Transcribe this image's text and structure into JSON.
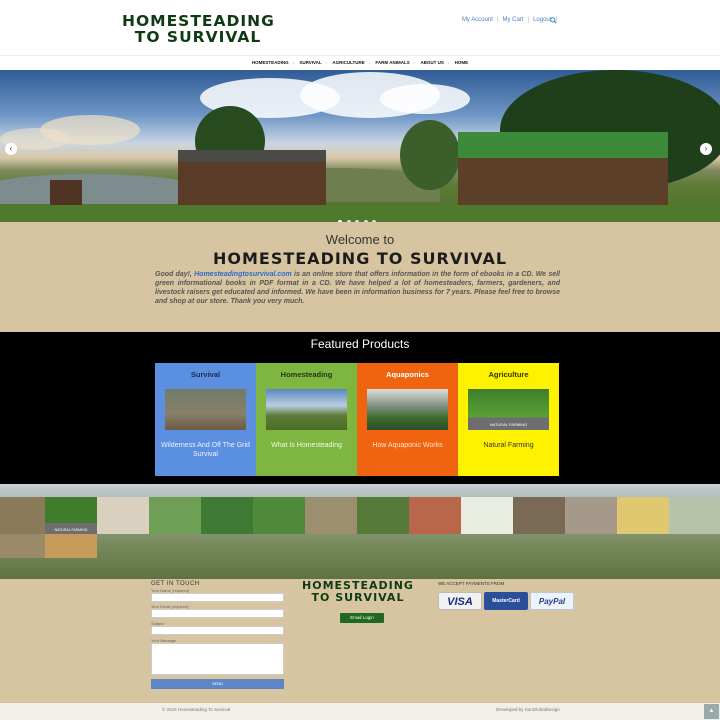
{
  "header": {
    "logo_line1": "HOMESTEADING",
    "logo_line2": "TO SURVIVAL",
    "my_account": "My Account",
    "my_cart": "My Cart",
    "logout": "Logout",
    "sep": "|"
  },
  "nav": {
    "items": [
      "HOMESTEADING",
      "SURVIVAL",
      "AGRICULTURE",
      "FARM ANIMALS",
      "ABOUT US",
      "HOME"
    ]
  },
  "hero": {
    "prev": "‹",
    "next": "›",
    "active_slide": 1,
    "slide_count": 5
  },
  "welcome": {
    "title": "Welcome to",
    "brand": "HOMESTEADING TO SURVIVAL",
    "intro_start": "Good day!, ",
    "intro_link": "Homesteadingtosurvival.com",
    "intro_rest": " is an online store that offers information in the form of ebooks in a CD. We sell green informational books in PDF format in a CD. We have helped a lot of homesteaders, farmers, gardeners, and livestock raisers get educated and informed. We have been in information business for 7 years. Please feel free to browse and shop at our store. Thank you very much."
  },
  "featured": {
    "title": "Featured Products",
    "cards": [
      {
        "title": "Survival",
        "desc": "Wilderness And Off The Grid Survival",
        "bg": "#5b8fe0",
        "title_color": "#1e2b4f",
        "desc_color": "#eef3ff"
      },
      {
        "title": "Homesteading",
        "desc": "What Is Homesteading",
        "bg": "#7fb641",
        "title_color": "#243814",
        "desc_color": "#f2f8e8"
      },
      {
        "title": "Aquaponics",
        "desc": "How Aquaponic Works",
        "bg": "#f0640f",
        "title_color": "#ffffff",
        "desc_color": "#ffe7d6"
      },
      {
        "title": "Agriculture",
        "desc": "Natural Farming",
        "bg": "#fff200",
        "title_color": "#333300",
        "desc_color": "#333333"
      }
    ],
    "natural_farming_caption": "NATURAL FARMING"
  },
  "collage": {
    "caption": "NATURAL FARMING"
  },
  "footer": {
    "contact_title": "GET IN TOUCH",
    "name_label": "Your Name (required)",
    "email_label": "Your Email (required)",
    "subject_label": "Subject",
    "message_label": "Your Message",
    "send": "SEND",
    "logo_line1": "HOMESTEADING",
    "logo_line2": "TO SURVIVAL",
    "login": "Email Login",
    "pay_title": "WE ACCEPT PAYMENTS FROM",
    "visa": "VISA",
    "mastercard": "MasterCard",
    "paypal": "PayPal"
  },
  "bottom": {
    "copyright": "© 2016 Homesteading To Survival",
    "developer": "Developed by SunGlobalDesign",
    "top": "▲"
  }
}
